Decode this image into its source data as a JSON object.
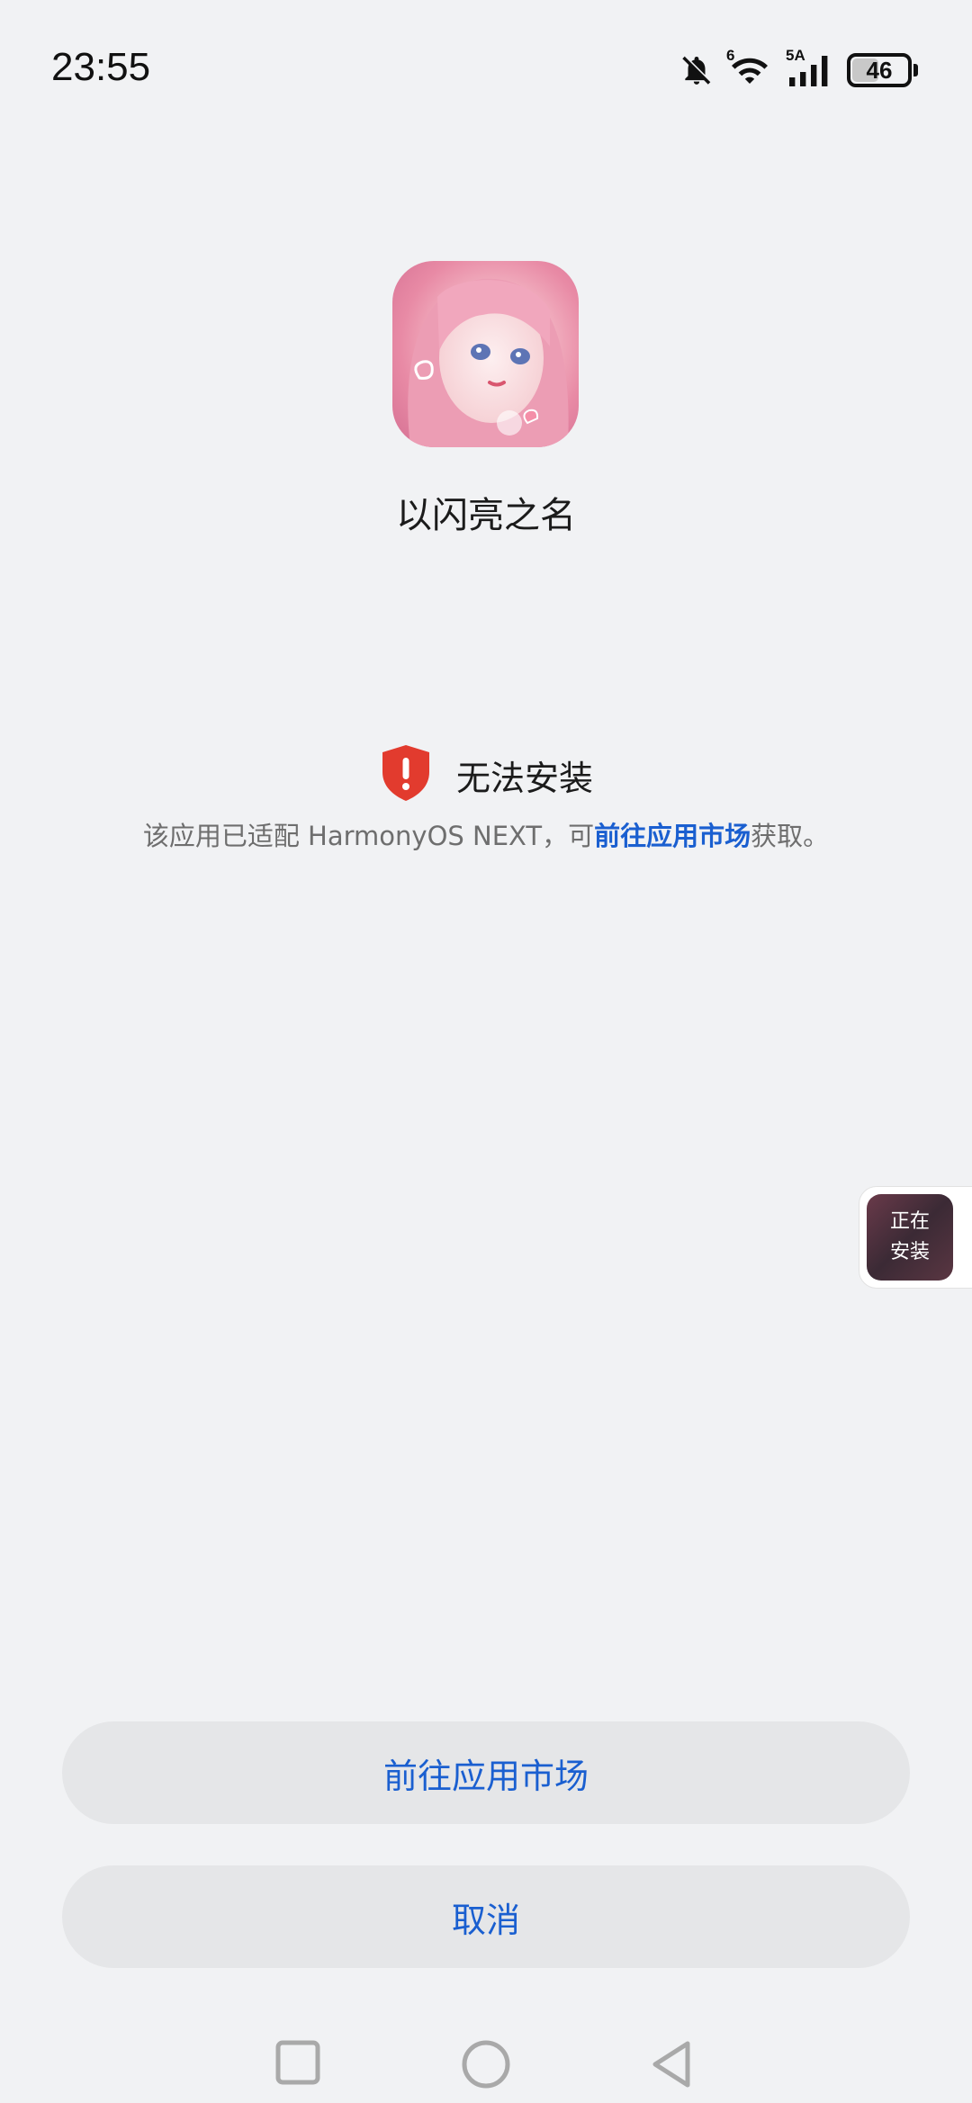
{
  "status_bar": {
    "time": "23:55",
    "network_label_1": "6",
    "network_label_2": "5A",
    "battery_level": "46",
    "icons": [
      "bell-off-icon",
      "wifi-icon",
      "signal-icon",
      "battery-icon"
    ]
  },
  "app": {
    "name": "以闪亮之名",
    "icon": "app-icon-anime-girl"
  },
  "error": {
    "title": "无法安装",
    "icon": "shield-alert-icon",
    "desc_prefix": "该应用已适配 HarmonyOS NEXT，可",
    "desc_link": "前往应用市场",
    "desc_suffix": "获取。"
  },
  "floating": {
    "label_line1": "正在",
    "label_line2": "安装"
  },
  "buttons": {
    "go_market": "前往应用市场",
    "cancel": "取消"
  },
  "nav": {
    "items": [
      "recent-apps-icon",
      "home-icon",
      "back-icon"
    ]
  },
  "colors": {
    "background": "#f1f2f4",
    "accent": "#1a5fd0",
    "error_red": "#e23b2e",
    "button_bg": "#e5e6e8"
  }
}
